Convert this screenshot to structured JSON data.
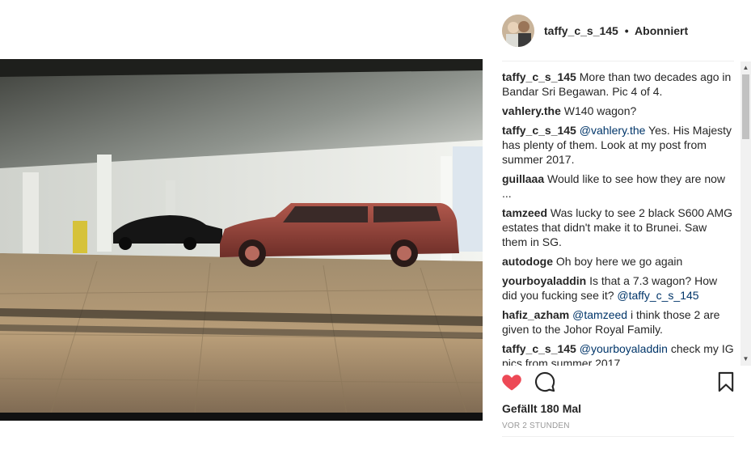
{
  "header": {
    "username": "taffy_c_s_145",
    "separator": "•",
    "follow_status": "Abonniert"
  },
  "comments": [
    {
      "user": "taffy_c_s_145",
      "mention": "",
      "text": "More than two decades ago in Bandar Sri Begawan. Pic 4 of 4."
    },
    {
      "user": "vahlery.the",
      "mention": "",
      "text": "W140 wagon?"
    },
    {
      "user": "taffy_c_s_145",
      "mention": "@vahlery.the",
      "text": "Yes. His Majesty has plenty of them. Look at my post from summer 2017."
    },
    {
      "user": "guillaaa",
      "mention": "",
      "text": "Would like to see how they are now ..."
    },
    {
      "user": "tamzeed",
      "mention": "",
      "text": "Was lucky to see 2 black S600 AMG estates that didn't make it to Brunei. Saw them in SG."
    },
    {
      "user": "autodoge",
      "mention": "",
      "text": "Oh boy here we go again"
    },
    {
      "user": "yourboyaladdin",
      "mention": "",
      "text": "Is that a 7.3 wagon? How did you fucking see it?",
      "trailing_mention": "@taffy_c_s_145"
    },
    {
      "user": "hafiz_azham",
      "mention": "@tamzeed",
      "text": "i think those 2 are given to the Johor Royal Family."
    },
    {
      "user": "taffy_c_s_145",
      "mention": "@yourboyaladdin",
      "text": "check my IG pics from summer 2017"
    }
  ],
  "actions": {
    "like_icon": "heart-filled-icon",
    "comment_icon": "comment-bubble-icon",
    "save_icon": "bookmark-icon",
    "like_color": "#ed4956"
  },
  "likes_text": "Gefällt 180 Mal",
  "timestamp": "VOR 2 STUNDEN",
  "scrollbar": {
    "up": "▲",
    "down": "▼"
  }
}
